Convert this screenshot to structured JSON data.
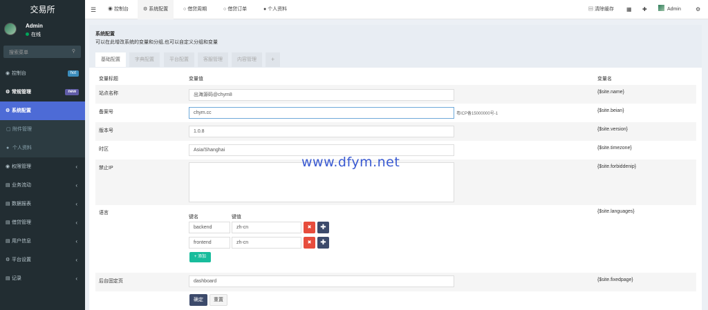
{
  "app": {
    "title": "交易所"
  },
  "user": {
    "name": "Admin",
    "status": "在线"
  },
  "sidebar": {
    "search_placeholder": "搜索菜单",
    "items": [
      {
        "label": "控制台",
        "badge": "hot"
      },
      {
        "label": "常规管理",
        "badge": "new"
      },
      {
        "label": "系统配置"
      },
      {
        "label": "附件管理"
      },
      {
        "label": "个人资料"
      },
      {
        "label": "权限管理"
      },
      {
        "label": "业务流动"
      },
      {
        "label": "数据报表"
      },
      {
        "label": "借贷管理"
      },
      {
        "label": "用户信息"
      },
      {
        "label": "平台设置"
      },
      {
        "label": "记录"
      }
    ]
  },
  "topbar": {
    "tabs": [
      "控制台",
      "系统配置",
      "借贷周期",
      "借贷订单",
      "个人资料"
    ],
    "clear_cache": "清除缓存",
    "admin": "Admin"
  },
  "panel": {
    "title": "系统配置",
    "description": "可以在此增改系统的变量和分组,也可以自定义分组和变量",
    "tabs": [
      "基础配置",
      "字典配置",
      "平台配置",
      "客服管理",
      "内容管理",
      "+"
    ]
  },
  "table": {
    "headers": {
      "title": "变量标题",
      "value": "变量值",
      "name": "变量名"
    },
    "rows": [
      {
        "label": "站点名称",
        "value": "出海源码@chym8",
        "name": "{$site.name}"
      },
      {
        "label": "备案号",
        "value": "chym.cc",
        "hint": "粤ICP备15000000号-1",
        "name": "{$site.beian}"
      },
      {
        "label": "版本号",
        "value": "1.0.8",
        "name": "{$site.version}"
      },
      {
        "label": "时区",
        "value": "Asia/Shanghai",
        "name": "{$site.timezone}"
      },
      {
        "label": "禁止IP",
        "value": "",
        "name": "{$site.forbiddenip}"
      },
      {
        "label": "语言",
        "name": "{$site.languages}"
      },
      {
        "label": "后台固定页",
        "value": "dashboard",
        "name": "{$site.fixedpage}"
      }
    ],
    "languages": {
      "key_header": "键名",
      "value_header": "键值",
      "pairs": [
        {
          "key": "backend",
          "value": "zh-cn"
        },
        {
          "key": "frontend",
          "value": "zh-cn"
        }
      ],
      "add_label": "添加"
    }
  },
  "actions": {
    "submit": "确定",
    "reset": "重置"
  },
  "watermark": "www.dfym.net",
  "colors": {
    "sidebar": "#222d32",
    "active": "#4d6bd6",
    "danger": "#e74c3c",
    "primary": "#3c4a6b",
    "success": "#18bc9c"
  }
}
